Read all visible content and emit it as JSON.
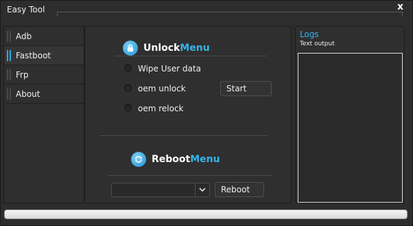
{
  "window": {
    "title": "Easy Tool",
    "close_glyph": "x"
  },
  "sidebar": {
    "items": [
      {
        "label": "Adb",
        "active": false
      },
      {
        "label": "Fastboot",
        "active": true
      },
      {
        "label": "Frp",
        "active": false
      },
      {
        "label": "About",
        "active": false
      }
    ]
  },
  "unlock_menu": {
    "title_white": "Unlock",
    "title_blue": "Menu",
    "icon": "lock-icon",
    "options": [
      "Wipe User data",
      "oem unlock",
      "oem relock"
    ],
    "start_label": "Start"
  },
  "reboot_menu": {
    "title_white": "Reboot",
    "title_blue": "Menu",
    "icon": "refresh-icon",
    "select_value": "",
    "reboot_label": "Reboot"
  },
  "logs": {
    "title": "Logs",
    "subtitle": "Text output",
    "content": ""
  },
  "progress": {
    "value": 0
  },
  "colors": {
    "accent": "#35b4ec",
    "background": "#2d2d2d"
  }
}
